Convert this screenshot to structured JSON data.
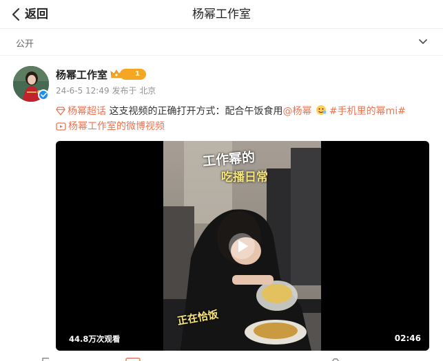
{
  "header": {
    "back_label": "返回",
    "title": "杨幂工作室"
  },
  "visibility": {
    "label": "公开"
  },
  "post": {
    "author": "杨幂工作室",
    "vip_level": "1",
    "time": "24-6-5 12:49",
    "source": "发布于 北京",
    "supertopic": "杨幂超话",
    "text": " 这支视频的正确打开方式：配合午饭食用",
    "mention": "@杨幂",
    "hashtag": "#手机里的幂mi#",
    "video_link": "杨幂工作室的微博视频"
  },
  "video": {
    "views": "44.8万次观看",
    "duration": "02:46",
    "caption_top_1": "工作幂的",
    "caption_top_2": "吃播日常",
    "caption_bottom": "正在恰饭"
  },
  "colors": {
    "link": "#eb7350",
    "verified": "#1d8ef0",
    "vip": "#f5a623"
  }
}
